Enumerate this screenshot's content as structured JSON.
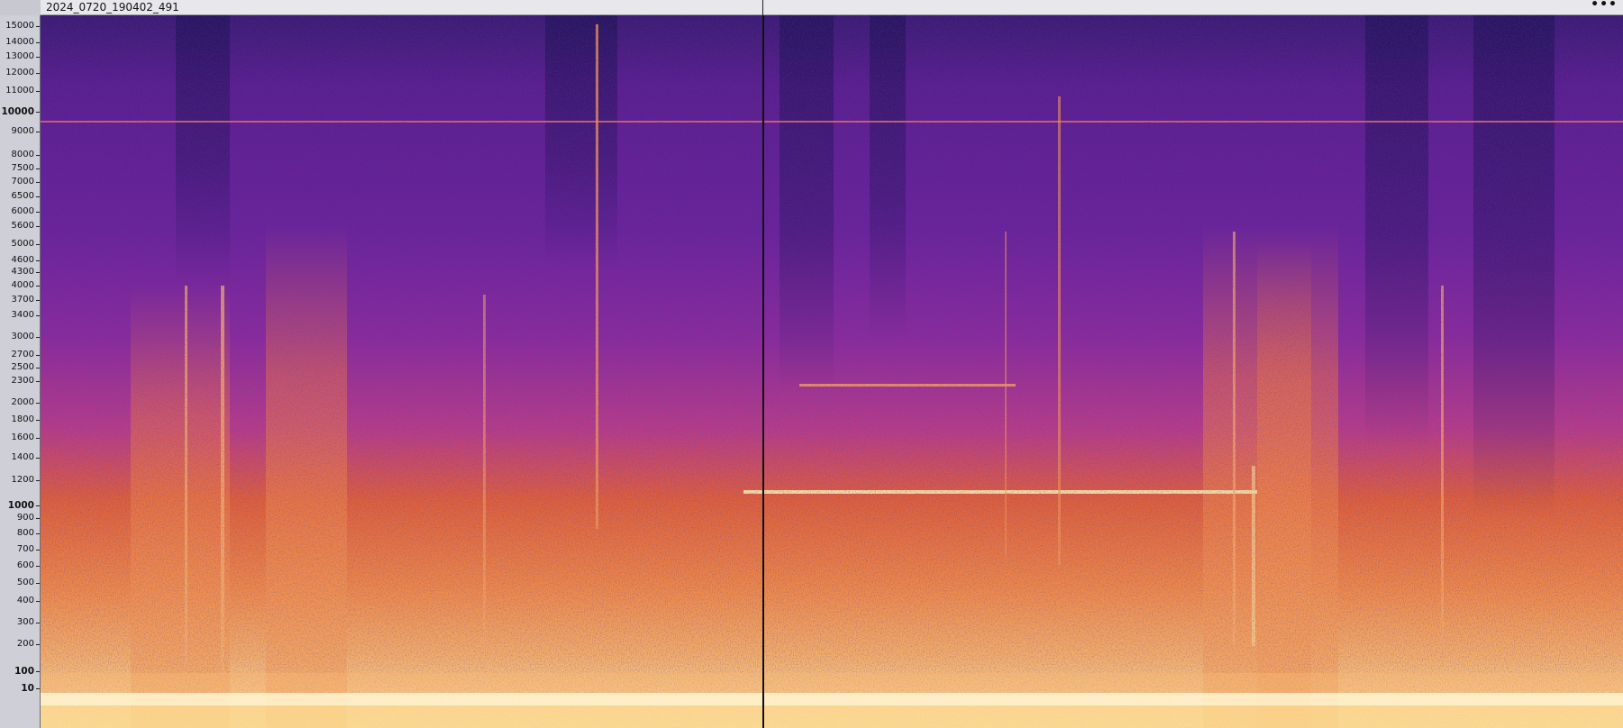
{
  "track": {
    "name": "2024_0720_190402_491",
    "menu_label": "•••"
  },
  "ruler": {
    "labels": [
      "15000",
      "14000",
      "13000",
      "12000",
      "11000",
      "10000",
      "9000",
      "8000",
      "7500",
      "7000",
      "6500",
      "6000",
      "5600",
      "5000",
      "4600",
      "4300",
      "4000",
      "3700",
      "3400",
      "3000",
      "2700",
      "2500",
      "2300",
      "2000",
      "1800",
      "1600",
      "1400",
      "1200",
      "1000",
      "900",
      "800",
      "700",
      "600",
      "500",
      "400",
      "300",
      "200",
      "100",
      "10"
    ],
    "major": [
      "10000",
      "1000",
      "100",
      "10"
    ]
  },
  "colors": {
    "cold": "#3a1a6e",
    "mid": "#8a2aa0",
    "warm": "#e0603a",
    "hot": "#f7c070",
    "white": "#fff6dc",
    "hum_line": "#e86a6a"
  }
}
